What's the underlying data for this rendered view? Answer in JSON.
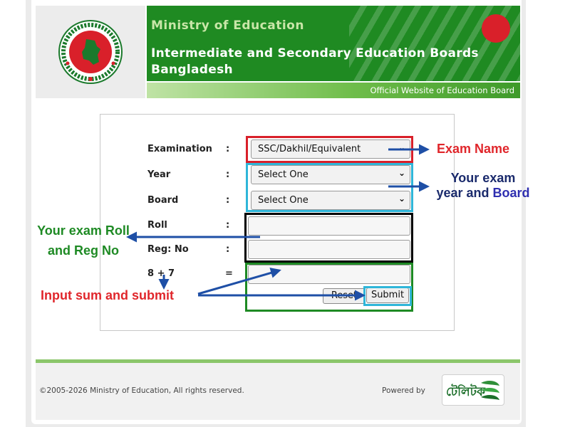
{
  "header": {
    "ministry": "Ministry of Education",
    "boards_line1": "Intermediate and Secondary Education Boards",
    "boards_line2": "Bangladesh",
    "official": "Official Website of Education Board"
  },
  "form": {
    "examination": {
      "label": "Examination",
      "colon": ":",
      "value": "SSC/Dakhil/Equivalent"
    },
    "year": {
      "label": "Year",
      "colon": ":",
      "value": "Select One"
    },
    "board": {
      "label": "Board",
      "colon": ":",
      "value": "Select One"
    },
    "roll": {
      "label": "Roll",
      "colon": ":",
      "value": ""
    },
    "reg": {
      "label": "Reg: No",
      "colon": ":",
      "value": ""
    },
    "captcha": {
      "label": "8 + 7",
      "equals": "=",
      "value": ""
    },
    "reset_label": "Reset",
    "submit_label": "Submit"
  },
  "annotations": {
    "exam_name": "Exam Name",
    "exam_year_line1": "Your exam",
    "exam_year_line2_a": "year and ",
    "exam_year_line2_b": "Board",
    "roll_reg_line1": "Your exam Roll",
    "roll_reg_line2": "and Reg No",
    "sum_submit": "Input sum and submit"
  },
  "footer": {
    "copyright": "©2005-2026 Ministry of Education, All rights reserved.",
    "powered": "Powered by",
    "teletalk": "টেলিটক"
  },
  "colors": {
    "header_green": "#1f8a22",
    "annotation_red": "#e0262b",
    "annotation_green": "#1e8a24",
    "annotation_navy": "#1a2a6c",
    "arrow_blue": "#1e4fa6",
    "highlight_red": "#d9202a",
    "highlight_cyan": "#2fb6d9",
    "highlight_black": "#000000",
    "highlight_green": "#1e8a24"
  }
}
